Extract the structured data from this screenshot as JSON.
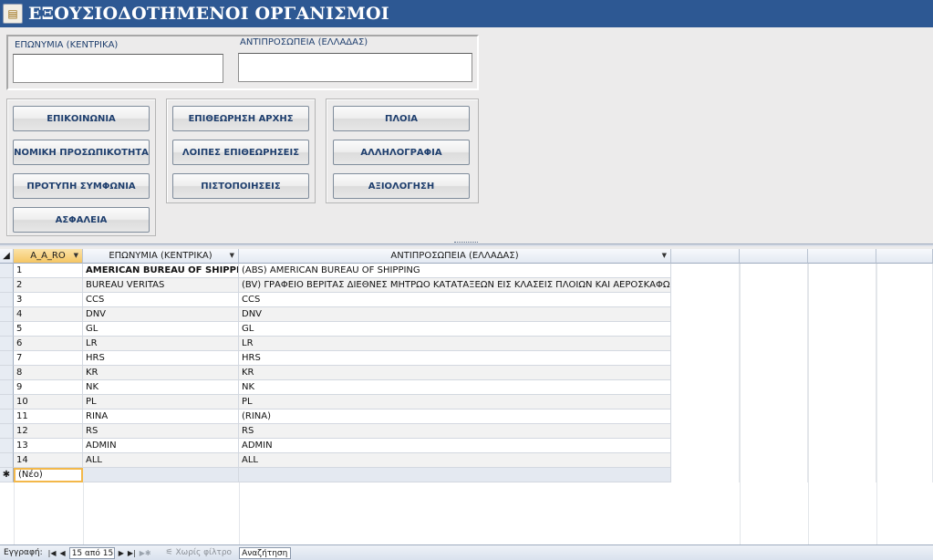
{
  "title": "ΕΞΟΥΣΙΟΔΟΤΗΜΕΝΟΙ ΟΡΓΑΝΙΣΜΟΙ",
  "title_icon": "form-icon",
  "fields": {
    "hq_label": "ΕΠΩΝΥΜΙΑ (ΚΕΝΤΡΙΚΑ)",
    "hq_value": "",
    "rep_label": "ΑΝΤΙΠΡΟΣΩΠΕΙΑ (ΕΛΛΑΔΑΣ)",
    "rep_value": ""
  },
  "buttons": {
    "group1": [
      "ΕΠΙΚΟΙΝΩΝΙΑ",
      "ΝΟΜΙΚΗ ΠΡΟΣΩΠΙΚΟΤΗΤΑ",
      "ΠΡΟΤΥΠΗ ΣΥΜΦΩΝΙΑ",
      "ΑΣΦΑΛΕΙΑ"
    ],
    "group2": [
      "ΕΠΙΘΕΩΡΗΣΗ ΑΡΧΗΣ",
      "ΛΟΙΠΕΣ ΕΠΙΘΕΩΡΗΣΕΙΣ",
      "ΠΙΣΤΟΠΟΙΗΣΕΙΣ"
    ],
    "group3": [
      "ΠΛΟΙΑ",
      "ΑΛΛΗΛΟΓΡΑΦΙΑ",
      "ΑΞΙΟΛΟΓΗΣΗ"
    ]
  },
  "table": {
    "columns": [
      "A_A_RO",
      "ΕΠΩΝΥΜΙΑ (ΚΕΝΤΡΙΚΑ)",
      "ΑΝΤΙΠΡΟΣΩΠΕΙΑ (ΕΛΛΑΔΑΣ)"
    ],
    "rows": [
      [
        "1",
        "AMERICAN BUREAU OF SHIPPING",
        "(ABS) AMERICAN BUREAU OF SHIPPING"
      ],
      [
        "2",
        "BUREAU VERITAS",
        "(BV) ΓΡΑΦΕΙΟ ΒΕΡΙΤΑΣ ΔΙΕΘΝΕΣ ΜΗΤΡΩΟ ΚΑΤΑΤΑΞΕΩΝ ΕΙΣ ΚΛΑΣΕΙΣ ΠΛΟΙΩΝ ΚΑΙ ΑΕΡΟΣΚΑΦΩΝ"
      ],
      [
        "3",
        "CCS",
        "CCS"
      ],
      [
        "4",
        "DNV",
        "DNV"
      ],
      [
        "5",
        "GL",
        "GL"
      ],
      [
        "6",
        "LR",
        "LR"
      ],
      [
        "7",
        "HRS",
        "HRS"
      ],
      [
        "8",
        "KR",
        "KR"
      ],
      [
        "9",
        "NK",
        "NK"
      ],
      [
        "10",
        "PL",
        "PL"
      ],
      [
        "11",
        "RINA",
        "(RINA)"
      ],
      [
        "12",
        "RS",
        "RS"
      ],
      [
        "13",
        "ADMIN",
        "ADMIN"
      ],
      [
        "14",
        "ALL",
        "ALL"
      ]
    ],
    "new_row_marker": "✱",
    "new_row_label": "(Νέο)"
  },
  "statusbar": {
    "record_label": "Εγγραφή:",
    "record_value": "15 από 15",
    "filter_label": "Χωρίς φίλτρο",
    "search_placeholder": "Αναζήτηση"
  }
}
